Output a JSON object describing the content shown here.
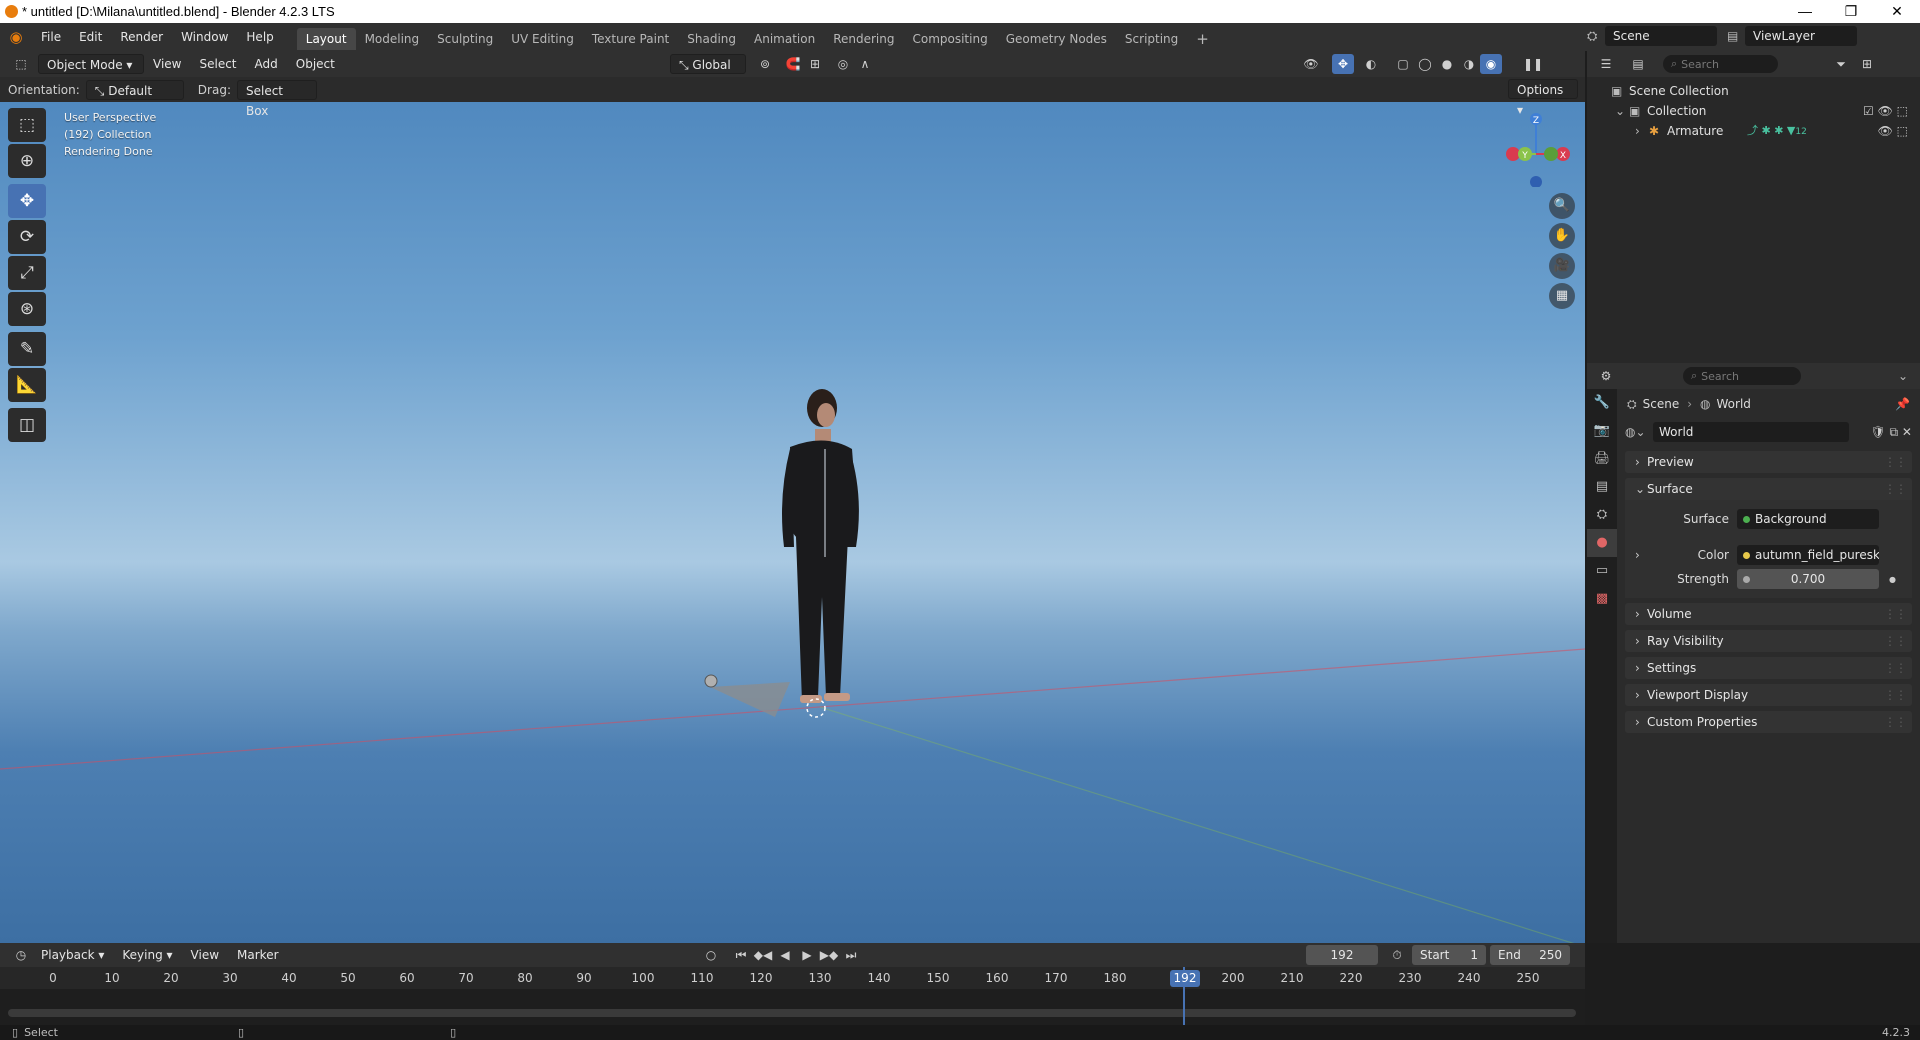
{
  "window": {
    "title": "* untitled [D:\\Milana\\untitled.blend] - Blender 4.2.3 LTS",
    "minimize": "—",
    "maximize": "❐",
    "close": "✕"
  },
  "menu": {
    "items": [
      "File",
      "Edit",
      "Render",
      "Window",
      "Help"
    ]
  },
  "workspaces": [
    "Layout",
    "Modeling",
    "Sculpting",
    "UV Editing",
    "Texture Paint",
    "Shading",
    "Animation",
    "Rendering",
    "Compositing",
    "Geometry Nodes",
    "Scripting"
  ],
  "workspace_add": "+",
  "scene_selector": {
    "label": "Scene"
  },
  "viewlayer_selector": {
    "label": "ViewLayer"
  },
  "viewport_header": {
    "mode": "Object Mode",
    "menus": [
      "View",
      "Select",
      "Add",
      "Object"
    ],
    "transform_orientation": "Global"
  },
  "tool_settings": {
    "orientation_label": "Orientation:",
    "orientation_value": "Default",
    "drag_label": "Drag:",
    "drag_value": "Select Box",
    "options": "Options"
  },
  "viewport_info": {
    "line1": "User Perspective",
    "line2": "(192) Collection",
    "line3": "Rendering Done"
  },
  "gizmo": {
    "x": "X",
    "y": "Y",
    "z": "Z"
  },
  "outliner": {
    "search_placeholder": "Search",
    "scene_collection": "Scene Collection",
    "collection": "Collection",
    "armature": "Armature",
    "armature_count": "12"
  },
  "properties": {
    "search_placeholder": "Search",
    "breadcrumb_scene": "Scene",
    "breadcrumb_world": "World",
    "world_name": "World",
    "panels": {
      "preview": "Preview",
      "surface": "Surface",
      "volume": "Volume",
      "ray_visibility": "Ray Visibility",
      "settings": "Settings",
      "viewport_display": "Viewport Display",
      "custom_properties": "Custom Properties"
    },
    "surface_label": "Surface",
    "surface_value": "Background",
    "color_label": "Color",
    "color_value": "autumn_field_puresk...",
    "strength_label": "Strength",
    "strength_value": "0.700"
  },
  "timeline": {
    "menus": [
      "Playback",
      "Keying",
      "View",
      "Marker"
    ],
    "current_frame": "192",
    "start_label": "Start",
    "start_value": "1",
    "end_label": "End",
    "end_value": "250",
    "ticks": [
      "0",
      "10",
      "20",
      "30",
      "40",
      "50",
      "60",
      "70",
      "80",
      "90",
      "100",
      "110",
      "120",
      "130",
      "140",
      "150",
      "160",
      "170",
      "180",
      "1",
      "200",
      "210",
      "220",
      "230",
      "240",
      "250"
    ],
    "playhead_label": "192"
  },
  "statusbar": {
    "left": "Select",
    "version": "4.2.3"
  },
  "colors": {
    "accent": "#4772b3",
    "world_tab": "#e06666",
    "axis_x": "#d93b4f",
    "axis_y": "#8bc34a",
    "axis_z": "#3f7fd6"
  }
}
